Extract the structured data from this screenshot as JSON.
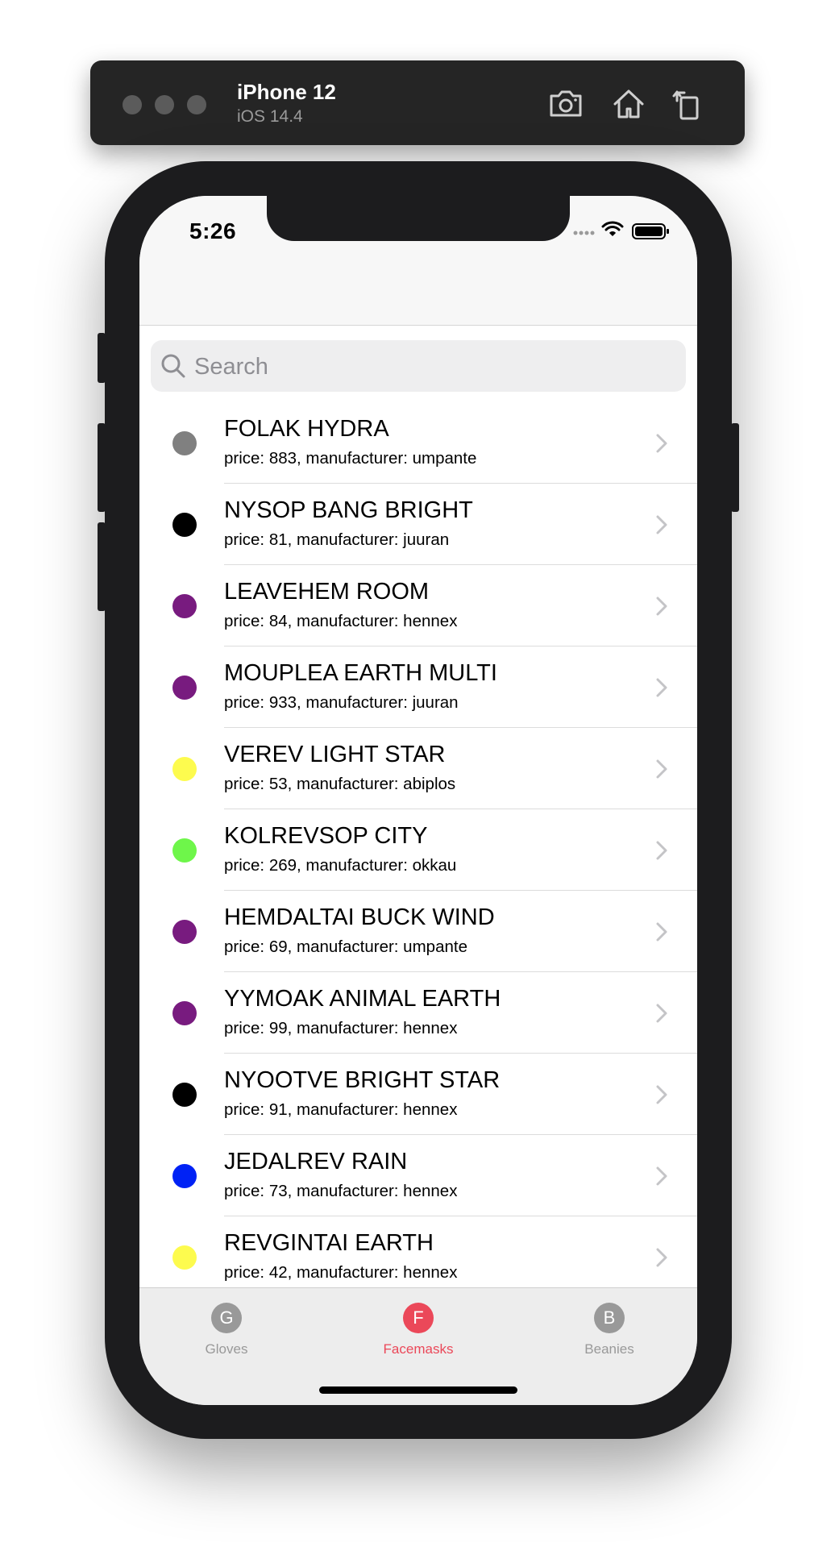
{
  "simulator": {
    "device_name": "iPhone 12",
    "os_version": "iOS 14.4",
    "icons": [
      "screenshot-icon",
      "home-icon",
      "rotate-icon"
    ]
  },
  "status_bar": {
    "time": "5:26"
  },
  "search": {
    "placeholder": "Search",
    "value": ""
  },
  "items": [
    {
      "title": "FOLAK HYDRA",
      "subtitle": "price: 883, manufacturer: umpante",
      "color": "#808080"
    },
    {
      "title": "NYSOP BANG BRIGHT",
      "subtitle": "price: 81, manufacturer: juuran",
      "color": "#000000"
    },
    {
      "title": "LEAVEHEM ROOM",
      "subtitle": "price: 84, manufacturer: hennex",
      "color": "#781b7f"
    },
    {
      "title": "MOUPLEA EARTH MULTI",
      "subtitle": "price: 933, manufacturer: juuran",
      "color": "#781b7f"
    },
    {
      "title": "VEREV LIGHT STAR",
      "subtitle": "price: 53, manufacturer: abiplos",
      "color": "#fdfb4e"
    },
    {
      "title": "KOLREVSOP CITY",
      "subtitle": "price: 269, manufacturer: okkau",
      "color": "#6ef64a"
    },
    {
      "title": "HEMDALTAI BUCK WIND",
      "subtitle": "price: 69, manufacturer: umpante",
      "color": "#781b7f"
    },
    {
      "title": "YYMOAK ANIMAL EARTH",
      "subtitle": "price: 99, manufacturer: hennex",
      "color": "#781b7f"
    },
    {
      "title": "NYOOTVE BRIGHT STAR",
      "subtitle": "price: 91, manufacturer: hennex",
      "color": "#000000"
    },
    {
      "title": "JEDALREV RAIN",
      "subtitle": "price: 73, manufacturer: hennex",
      "color": "#0022f5"
    },
    {
      "title": "REVGINTAI EARTH",
      "subtitle": "price: 42, manufacturer: hennex",
      "color": "#fdfb4e"
    }
  ],
  "tabs": [
    {
      "letter": "G",
      "label": "Gloves",
      "active": false
    },
    {
      "letter": "F",
      "label": "Facemasks",
      "active": true
    },
    {
      "letter": "B",
      "label": "Beanies",
      "active": false
    }
  ],
  "colors": {
    "accent": "#eb4859",
    "inactive": "#999999",
    "chevron": "#c4c4c7"
  }
}
